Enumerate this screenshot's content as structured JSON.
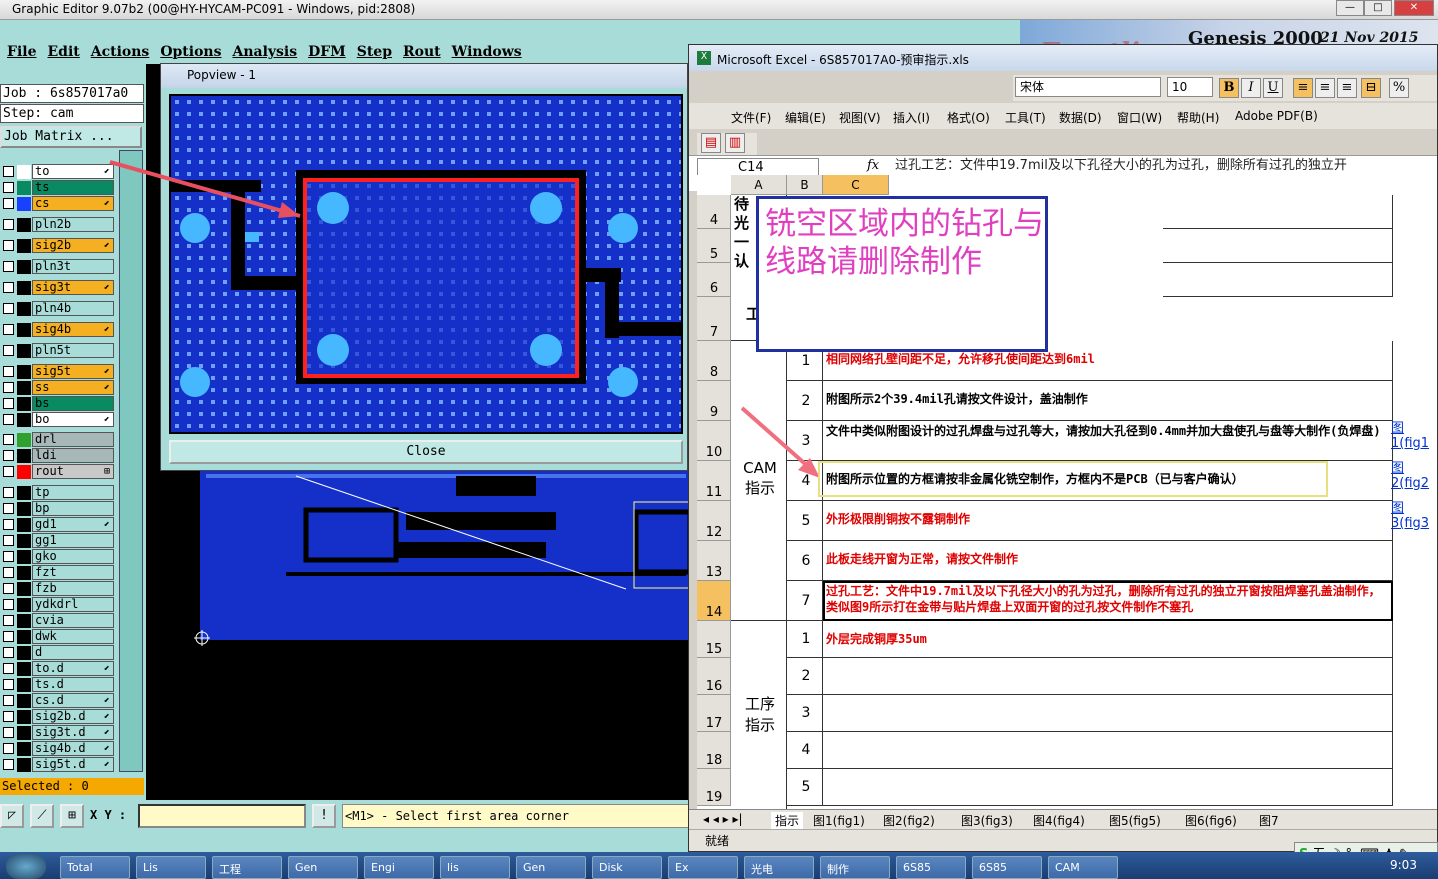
{
  "genesis": {
    "title": "Graphic Editor 9.07b2 (00@HY-HYCAM-PC091 - Windows, pid:2808)",
    "menu": [
      "File",
      "Edit",
      "Actions",
      "Options",
      "Analysis",
      "DFM",
      "Step",
      "Rout",
      "Windows"
    ],
    "banner_logo": "Frontline",
    "banner_title": "Genesis 2000",
    "banner_date": "21 Nov 2015",
    "job": "Job : 6s857017a0",
    "step": "Step: cam",
    "job_matrix": "Job Matrix ...",
    "layers": [
      {
        "name": "to",
        "color": "#ffffff",
        "bg": "#ffffff",
        "arrow": "⬋"
      },
      {
        "name": "ts",
        "color": "#0a8a60",
        "bg": "#0a8a60",
        "arrow": ""
      },
      {
        "name": "cs",
        "color": "#1a40ff",
        "bg": "#f4b020",
        "arrow": "⬋"
      },
      {
        "name": "pln2b",
        "color": "#000000",
        "bg": "#a8dcd8",
        "arrow": ""
      },
      {
        "name": "sig2b",
        "color": "#000000",
        "bg": "#f4b020",
        "arrow": "⬋"
      },
      {
        "name": "pln3t",
        "color": "#000000",
        "bg": "#a8dcd8",
        "arrow": ""
      },
      {
        "name": "sig3t",
        "color": "#000000",
        "bg": "#f4b020",
        "arrow": "⬋"
      },
      {
        "name": "pln4b",
        "color": "#000000",
        "bg": "#a8dcd8",
        "arrow": ""
      },
      {
        "name": "sig4b",
        "color": "#000000",
        "bg": "#f4b020",
        "arrow": "⬋"
      },
      {
        "name": "pln5t",
        "color": "#000000",
        "bg": "#a8dcd8",
        "arrow": ""
      },
      {
        "name": "sig5t",
        "color": "#000000",
        "bg": "#f4b020",
        "arrow": "⬋"
      },
      {
        "name": "ss",
        "color": "#000000",
        "bg": "#f4b020",
        "arrow": "⬋"
      },
      {
        "name": "bs",
        "color": "#000000",
        "bg": "#0a8a60",
        "arrow": ""
      },
      {
        "name": "bo",
        "color": "#000000",
        "bg": "#ffffff",
        "arrow": "⬋"
      },
      {
        "name": "drl",
        "color": "#30a030",
        "bg": "#a8b8b8",
        "arrow": ""
      },
      {
        "name": "ldi",
        "color": "#000000",
        "bg": "#a8b8b8",
        "arrow": ""
      },
      {
        "name": "rout",
        "color": "#ff0000",
        "bg": "#c8c8c8",
        "arrow": "⊞"
      },
      {
        "name": "tp",
        "color": "#000000",
        "bg": "#a8dcd8",
        "arrow": ""
      },
      {
        "name": "bp",
        "color": "#000000",
        "bg": "#a8dcd8",
        "arrow": ""
      },
      {
        "name": "gd1",
        "color": "#000000",
        "bg": "#a8dcd8",
        "arrow": "⬋"
      },
      {
        "name": "gg1",
        "color": "#000000",
        "bg": "#a8dcd8",
        "arrow": ""
      },
      {
        "name": "gko",
        "color": "#000000",
        "bg": "#a8dcd8",
        "arrow": ""
      },
      {
        "name": "fzt",
        "color": "#000000",
        "bg": "#a8dcd8",
        "arrow": ""
      },
      {
        "name": "fzb",
        "color": "#000000",
        "bg": "#a8dcd8",
        "arrow": ""
      },
      {
        "name": "ydkdrl",
        "color": "#000000",
        "bg": "#a8dcd8",
        "arrow": ""
      },
      {
        "name": "cvia",
        "color": "#000000",
        "bg": "#a8dcd8",
        "arrow": ""
      },
      {
        "name": "dwk",
        "color": "#000000",
        "bg": "#a8dcd8",
        "arrow": ""
      },
      {
        "name": "d",
        "color": "#000000",
        "bg": "#a8dcd8",
        "arrow": ""
      },
      {
        "name": "to.d",
        "color": "#000000",
        "bg": "#a8dcd8",
        "arrow": "⬋"
      },
      {
        "name": "ts.d",
        "color": "#000000",
        "bg": "#a8dcd8",
        "arrow": ""
      },
      {
        "name": "cs.d",
        "color": "#000000",
        "bg": "#a8dcd8",
        "arrow": "⬋"
      },
      {
        "name": "sig2b.d",
        "color": "#000000",
        "bg": "#a8dcd8",
        "arrow": "⬋"
      },
      {
        "name": "sig3t.d",
        "color": "#000000",
        "bg": "#a8dcd8",
        "arrow": "⬋"
      },
      {
        "name": "sig4b.d",
        "color": "#000000",
        "bg": "#a8dcd8",
        "arrow": "⬋"
      },
      {
        "name": "sig5t.d",
        "color": "#000000",
        "bg": "#a8dcd8",
        "arrow": "⬋"
      }
    ],
    "selected": "Selected : 0",
    "xy_label": "X Y :",
    "prompt": "<M1> - Select first area corner",
    "popview_title": "Popview - 1",
    "close_label": "Close"
  },
  "excel": {
    "title": "Microsoft Excel - 6S857017A0-预审指示.xls",
    "font_name": "宋体",
    "font_size": "10",
    "menu": [
      "文件(F)",
      "编辑(E)",
      "视图(V)",
      "插入(I)",
      "格式(O)",
      "工具(T)",
      "数据(D)",
      "窗口(W)",
      "帮助(H)",
      "Adobe PDF(B)"
    ],
    "name_box": "C14",
    "formula": "过孔工艺：文件中19.7mil及以下孔径大小的孔为过孔，删除所有过孔的独立开\n所示打在金带与贴片焊盘上双面开窗的过孔按文件制作不塞孔",
    "columns": [
      "A",
      "B",
      "C"
    ],
    "top_fragments": [
      "待",
      "光",
      "一",
      "认",
      "工"
    ],
    "group_cam": "CAM\n指示",
    "group_proc": "工序\n指示",
    "rows": [
      {
        "row": "4"
      },
      {
        "row": "5"
      },
      {
        "row": "6"
      },
      {
        "row": "7"
      },
      {
        "row": "8",
        "num": "1",
        "text": "相同网络孔壁间距不足，允许移孔使间距达到6mil",
        "cls": "red"
      },
      {
        "row": "9",
        "num": "2",
        "text": "附图所示2个39.4mil孔请按文件设计，盖油制作",
        "cls": "blk"
      },
      {
        "row": "10",
        "num": "3",
        "text": "文件中类似附图设计的过孔焊盘与过孔等大，请按加大孔径到0.4mm并加大盘使孔与盘等大制作(负焊盘)",
        "cls": "blk"
      },
      {
        "row": "11",
        "num": "4",
        "text": "附图所示位置的方框请按非金属化铣空制作，方框内不是PCB（已与客户确认）",
        "cls": "blk"
      },
      {
        "row": "12",
        "num": "5",
        "text": "外形极限削铜按不露铜制作",
        "cls": "red"
      },
      {
        "row": "13",
        "num": "6",
        "text": "此板走线开窗为正常，请按文件制作",
        "cls": "red"
      },
      {
        "row": "14",
        "num": "7",
        "text": "过孔工艺：文件中19.7mil及以下孔径大小的孔为过孔，删除所有过孔的独立开窗按阻焊塞孔盖油制作，类似图9所示打在金带与贴片焊盘上双面开窗的过孔按文件制作不塞孔",
        "cls": "red"
      },
      {
        "row": "15",
        "num": "1",
        "text": "外层完成铜厚35um",
        "cls": "red"
      },
      {
        "row": "16",
        "num": "2",
        "text": "",
        "cls": "red"
      },
      {
        "row": "17",
        "num": "3",
        "text": "",
        "cls": "red"
      },
      {
        "row": "18",
        "num": "4",
        "text": "",
        "cls": "red"
      },
      {
        "row": "19",
        "num": "5",
        "text": "",
        "cls": "red"
      }
    ],
    "links": [
      {
        "a": "图",
        "b": "1(fig1"
      },
      {
        "a": "图",
        "b": "2(fig2"
      },
      {
        "a": "图",
        "b": "3(fig3"
      }
    ],
    "note": "铣空区域内的钻孔与线路请删除制作",
    "sheet_tabs": [
      "指示",
      "图1(fig1)",
      "图2(fig2)",
      "图3(fig3)",
      "图4(fig4)",
      "图5(fig5)",
      "图6(fig6)",
      "图7"
    ],
    "status": "就绪"
  },
  "taskbar": {
    "tasks": [
      "Total",
      "Lis",
      "工程",
      "Gen",
      "Engi",
      "lis",
      "Gen",
      "Disk",
      "Ex",
      "光电",
      "制作",
      "6S85",
      "6S85",
      "CAM"
    ],
    "time": "9:03",
    "ime": "五"
  },
  "colors": {
    "board": "#1530c8",
    "highlight": "#ff2020",
    "note_border": "#2030a0",
    "note_text": "#e040c0"
  }
}
